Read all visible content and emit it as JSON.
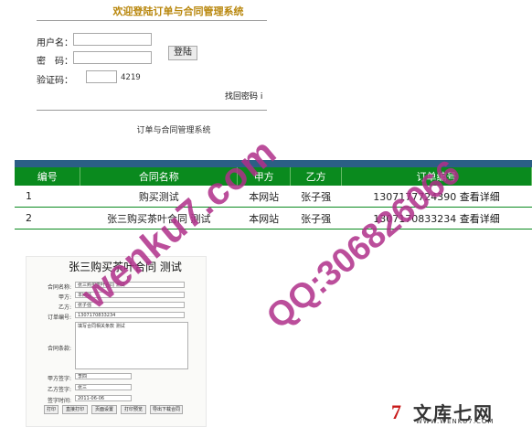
{
  "login": {
    "title": "欢迎登陆订单与合同管理系统",
    "username_label": "用户名：",
    "password_label": "密　码：",
    "captcha_label": "验证码：",
    "captcha_code": "4219",
    "login_button": "登陆",
    "forgot_link": "找回密码",
    "forgot_suffix": "i"
  },
  "system_title": "订单与合同管理系统",
  "table": {
    "headers": [
      "编号",
      "合同名称",
      "甲方",
      "乙方",
      "订单编号"
    ],
    "rows": [
      {
        "id": "1",
        "name": "购买测试",
        "party_a": "本网站",
        "party_b": "张子强",
        "order_no": "1307177724390",
        "action": "查看详细"
      },
      {
        "id": "2",
        "name": "张三购买茶叶合同 测试",
        "party_a": "本网站",
        "party_b": "张子强",
        "order_no": "1307170833234",
        "action": "查看详细"
      }
    ]
  },
  "contract_form": {
    "title": "张三购买茶叶合同 测试",
    "name_label": "合同名称:",
    "name_value": "张三购买茶叶合同 测试",
    "party_a_label": "甲方:",
    "party_a_value": "本网站",
    "party_b_label": "乙方:",
    "party_b_value": "张子强",
    "order_label": "订单编号:",
    "order_value": "1307170833234",
    "content_label": "合同条款:",
    "content_value": "填写合同相关条款 测试",
    "sign_a_label": "甲方签字:",
    "sign_a_value": "李四",
    "sign_b_label": "乙方签字:",
    "sign_b_value": "张三",
    "sign_time_label": "签字时间:",
    "sign_time_value": "2011-06-06",
    "buttons": [
      "打印",
      "直接打印",
      "页面设置",
      "打印预览",
      "导出下载合同"
    ]
  },
  "watermark": {
    "site": "wenku7.com",
    "qq": "QQ:306826066"
  },
  "logo": {
    "mark": "7",
    "text": "文库七网",
    "url": "WWW.WENKU7.COM"
  },
  "colors": {
    "header_green": "#0a8a1e",
    "top_bar": "#2b5f85",
    "watermark": "#b0308a",
    "title_gold": "#b8860b"
  }
}
